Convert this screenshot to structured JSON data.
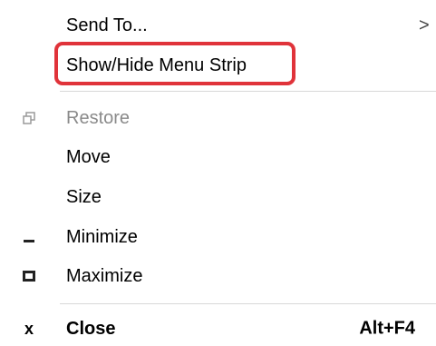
{
  "menu": {
    "items": [
      {
        "label": "Send To...",
        "submenu_arrow": ">",
        "icon": "none",
        "enabled": true
      },
      {
        "label": "Show/Hide Menu Strip",
        "icon": "none",
        "enabled": true,
        "highlighted": true
      },
      {
        "label": "Restore",
        "icon": "restore-icon",
        "enabled": false
      },
      {
        "label": "Move",
        "icon": "none",
        "enabled": true
      },
      {
        "label": "Size",
        "icon": "none",
        "enabled": true
      },
      {
        "label": "Minimize",
        "icon": "minimize-icon",
        "enabled": true
      },
      {
        "label": "Maximize",
        "icon": "maximize-icon",
        "enabled": true
      },
      {
        "label": "Close",
        "icon": "close-icon",
        "icon_glyph": "x",
        "shortcut": "Alt+F4",
        "enabled": true
      }
    ]
  },
  "colors": {
    "highlight_border": "#e0333a",
    "disabled_text": "#8a8a8a",
    "separator": "#d8d8d8"
  }
}
